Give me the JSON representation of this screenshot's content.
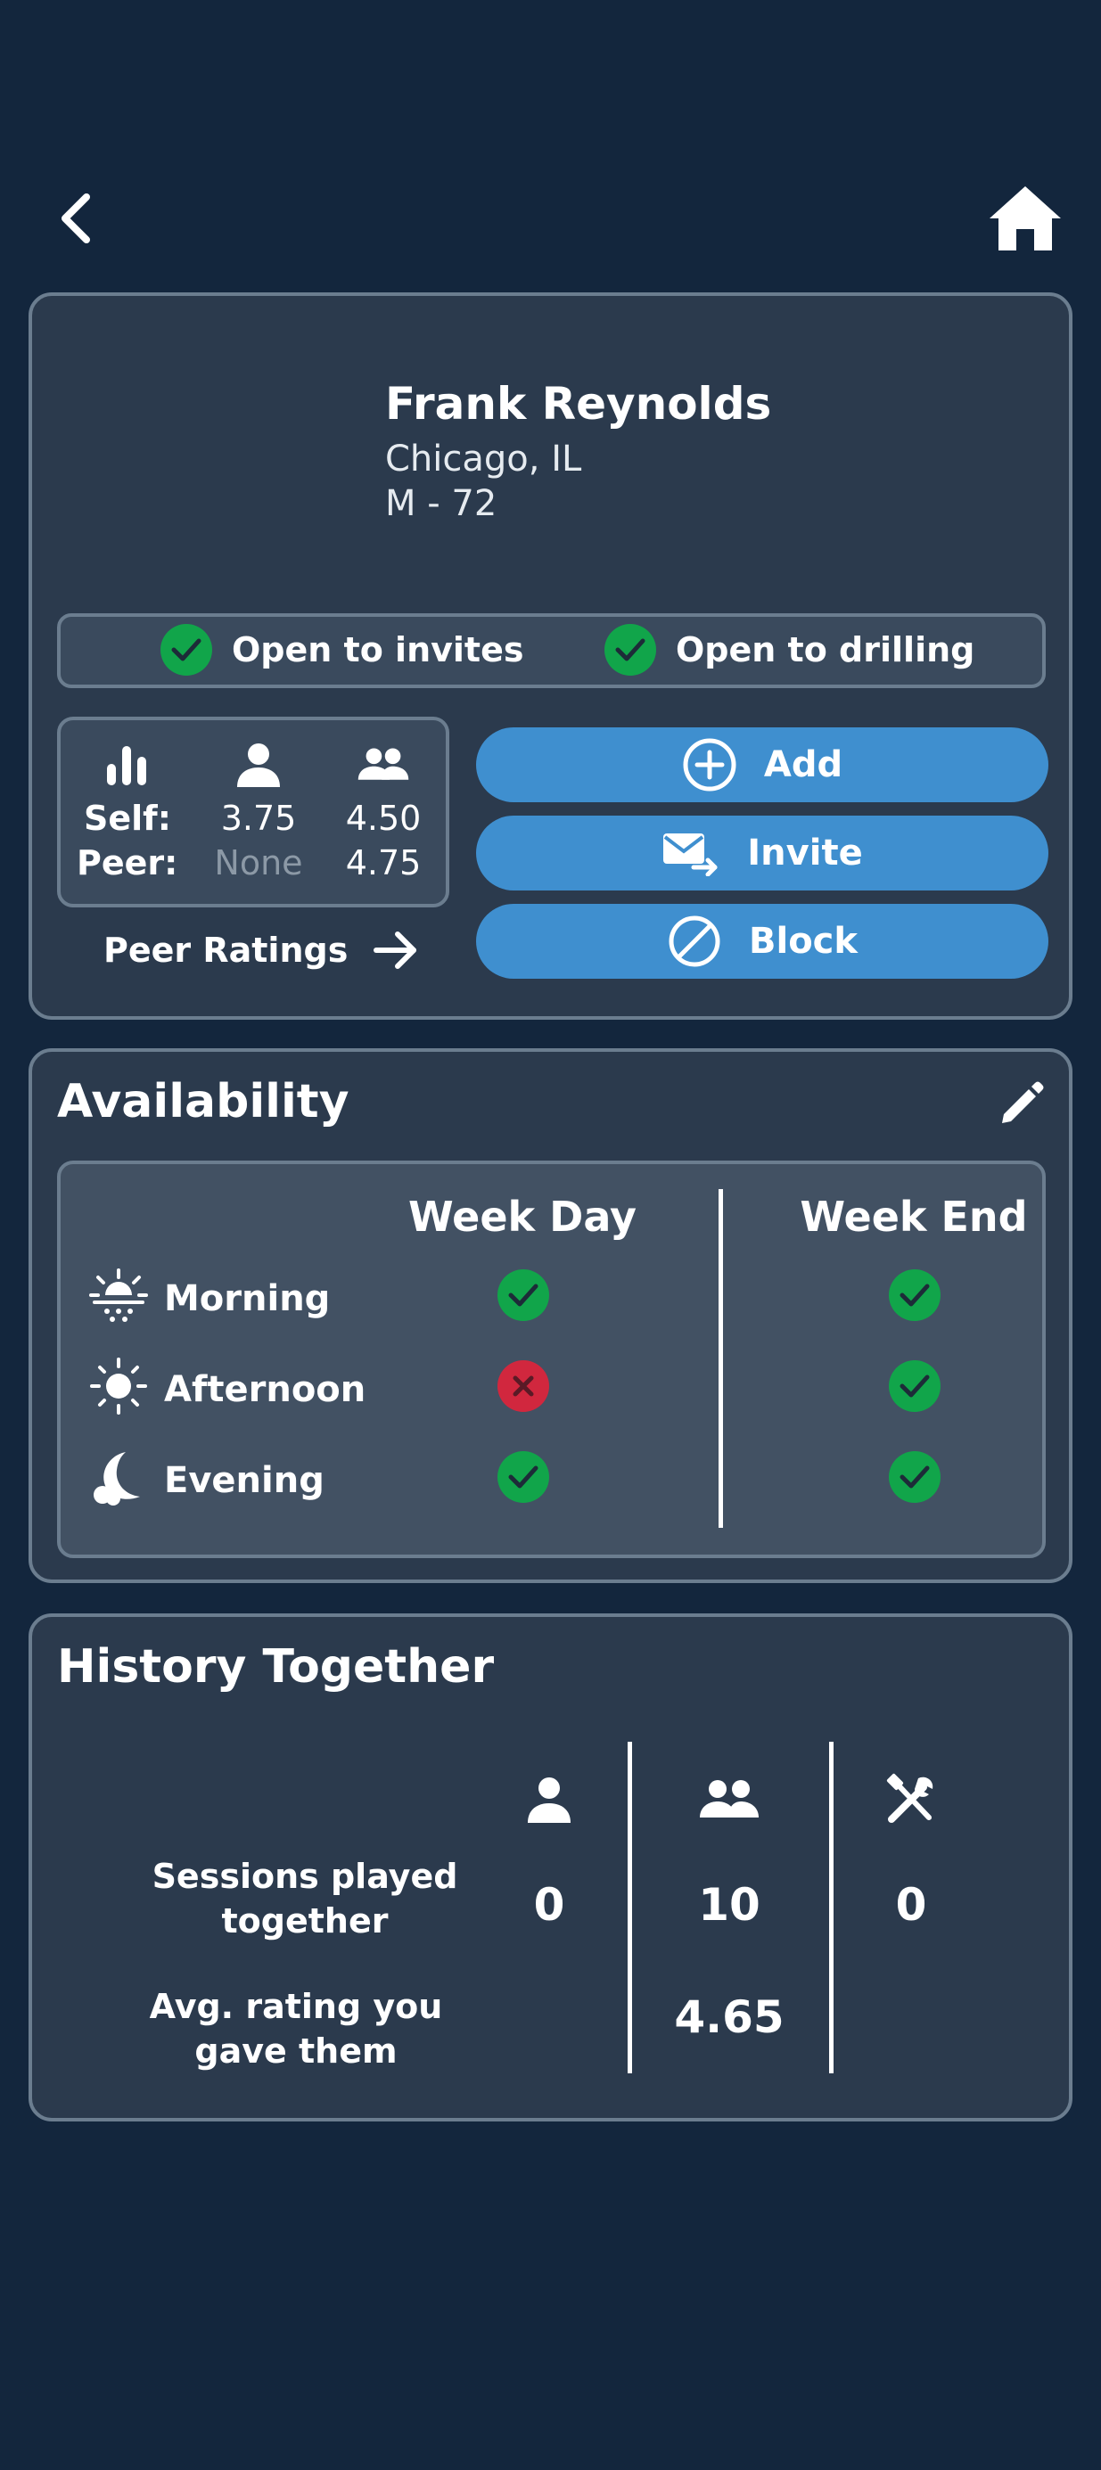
{
  "profile": {
    "name": "Frank Reynolds",
    "location": "Chicago, IL",
    "demographic": "M - 72",
    "status": {
      "invites_label": "Open to invites",
      "drilling_label": "Open to drilling"
    },
    "ratings": {
      "self_label": "Self:",
      "peer_label": "Peer:",
      "self_singles": "3.75",
      "self_doubles": "4.50",
      "peer_singles": "None",
      "peer_doubles": "4.75",
      "icons": [
        "bar-chart-icon",
        "person-icon",
        "people-icon"
      ]
    },
    "peer_ratings_link": "Peer Ratings",
    "actions": {
      "add_label": "Add",
      "invite_label": "Invite",
      "block_label": "Block"
    }
  },
  "availability": {
    "title": "Availability",
    "columns": [
      "Week Day",
      "Week End"
    ],
    "rows": [
      {
        "label": "Morning",
        "icon": "sunrise-icon",
        "weekday": "available",
        "weekend": "available"
      },
      {
        "label": "Afternoon",
        "icon": "sun-icon",
        "weekday": "unavailable",
        "weekend": "available"
      },
      {
        "label": "Evening",
        "icon": "moon-icon",
        "weekday": "available",
        "weekend": "available"
      }
    ]
  },
  "history": {
    "title": "History Together",
    "column_icons": [
      "person-icon",
      "people-icon",
      "tools-icon"
    ],
    "sessions_label": "Sessions played together",
    "sessions": [
      "0",
      "10",
      "0"
    ],
    "avg_rating_label": "Avg. rating you gave them",
    "avg_rating": "4.65"
  },
  "colors": {
    "background": "#13263d",
    "card": "#2b3a4d",
    "border": "#6b7d8f",
    "button": "#3f8fcf",
    "available": "#11a54a",
    "unavailable": "#d1273e"
  }
}
